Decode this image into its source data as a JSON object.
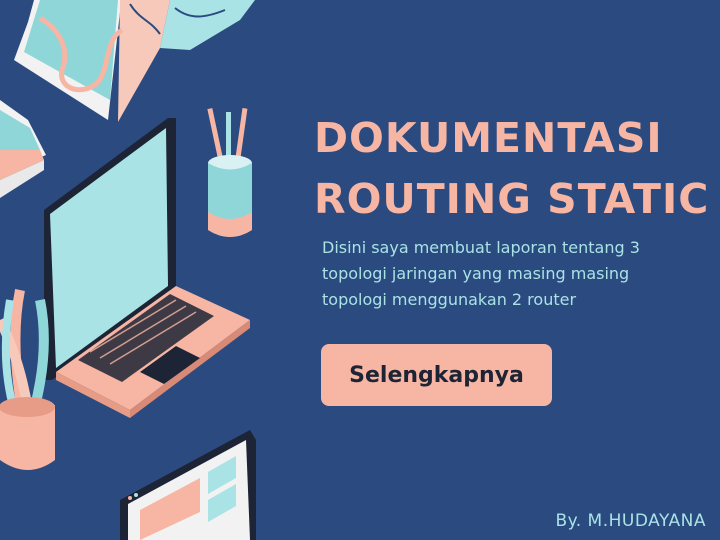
{
  "slide": {
    "title_line1": "DOKUMENTASI",
    "title_line2": "ROUTING STATIC",
    "description": "Disini saya membuat laporan tentang 3 topologi jaringan yang masing masing topologi menggunakan 2 router",
    "button_label": "Selengkapnya",
    "author": "By. M.HUDAYANA"
  },
  "colors": {
    "background": "#2b4a80",
    "accent_peach": "#f7b6a3",
    "accent_teal": "#a9e3e5",
    "dark_navy": "#1d2435"
  },
  "icons": [
    "map-icon",
    "books-icon",
    "pencil-cup-icon",
    "laptop-icon",
    "plant-icon",
    "browser-window-icon"
  ]
}
